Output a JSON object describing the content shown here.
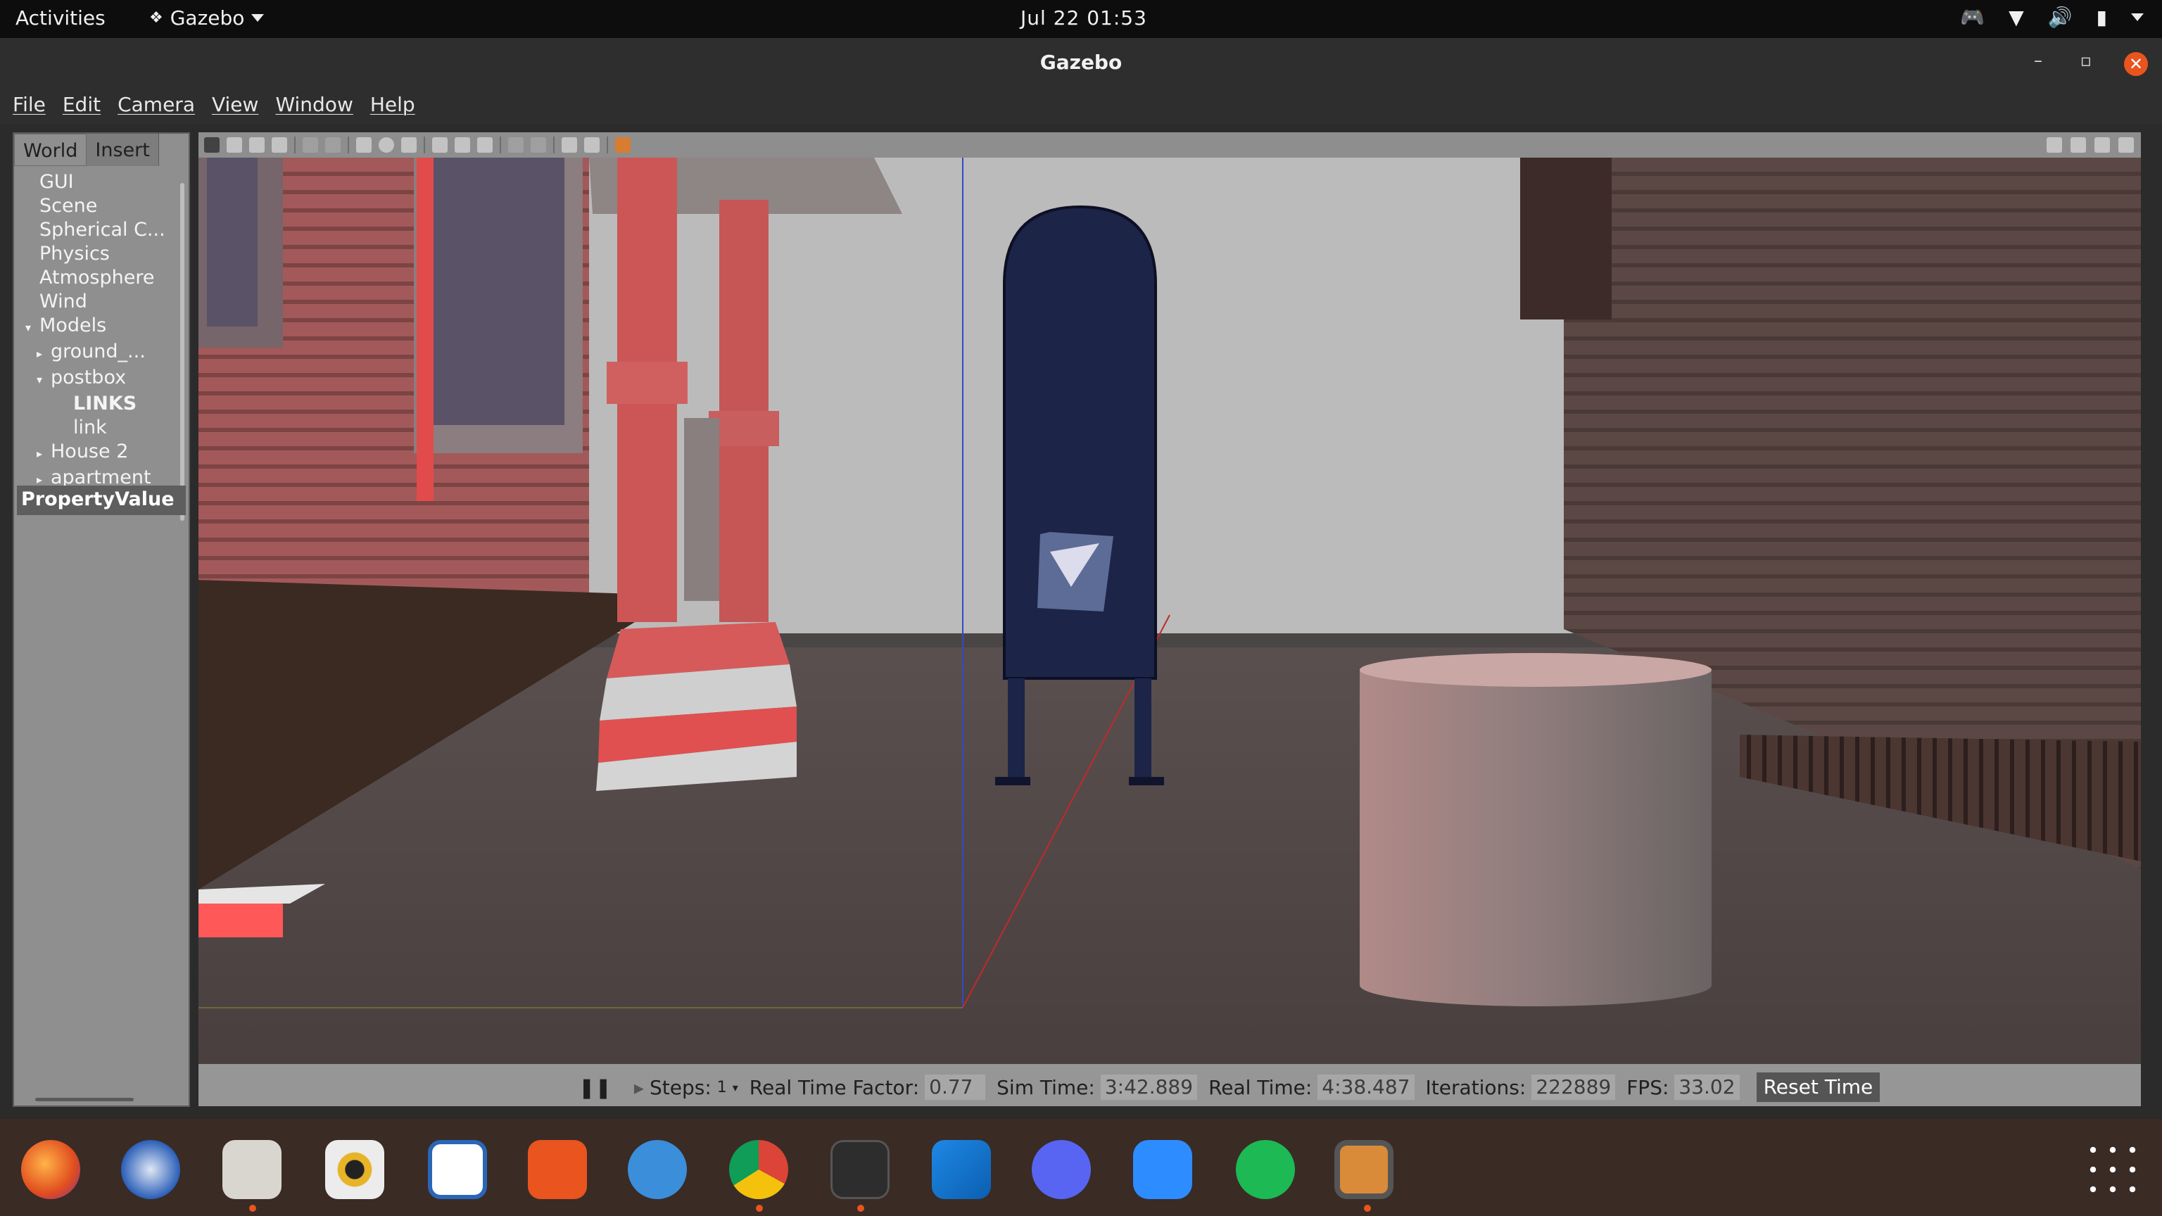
{
  "topbar": {
    "activities": "Activities",
    "app_name": "Gazebo",
    "clock": "Jul 22  01:53",
    "tray_icons": [
      "discord-tray-icon",
      "wifi-icon",
      "volume-icon",
      "battery-icon",
      "chevron-down-icon"
    ]
  },
  "window": {
    "title": "Gazebo",
    "minimize": "–",
    "maximize": "▫",
    "close": "✕"
  },
  "menu": [
    "File",
    "Edit",
    "Camera",
    "View",
    "Window",
    "Help"
  ],
  "left_panel": {
    "tabs": [
      "World",
      "Insert"
    ],
    "tree": [
      {
        "label": "GUI",
        "indent": 1,
        "arrow": ""
      },
      {
        "label": "Scene",
        "indent": 1,
        "arrow": ""
      },
      {
        "label": "Spherical C...",
        "indent": 1,
        "arrow": ""
      },
      {
        "label": "Physics",
        "indent": 1,
        "arrow": ""
      },
      {
        "label": "Atmosphere",
        "indent": 1,
        "arrow": ""
      },
      {
        "label": "Wind",
        "indent": 1,
        "arrow": ""
      },
      {
        "label": "Models",
        "indent": 1,
        "arrow": "▾"
      },
      {
        "label": "ground_...",
        "indent": 2,
        "arrow": "▸"
      },
      {
        "label": "postbox",
        "indent": 2,
        "arrow": "▾"
      },
      {
        "label": "LINKS",
        "indent": 3,
        "arrow": "",
        "bold": true
      },
      {
        "label": "link",
        "indent": 3,
        "arrow": ""
      },
      {
        "label": "House 2",
        "indent": 2,
        "arrow": "▸"
      },
      {
        "label": "apartment",
        "indent": 2,
        "arrow": "▸"
      }
    ],
    "property_header": "PropertyValue"
  },
  "status": {
    "steps_label": "Steps:",
    "steps_value": "1",
    "rtf_label": "Real Time Factor:",
    "rtf_value": "0.77",
    "sim_time_label": "Sim Time:",
    "sim_time_value": "3:42.889",
    "real_time_label": "Real Time:",
    "real_time_value": "4:38.487",
    "iterations_label": "Iterations:",
    "iterations_value": "222889",
    "fps_label": "FPS:",
    "fps_value": "33.02",
    "reset_label": "Reset Time"
  },
  "dock": [
    "firefox-icon",
    "thunderbird-icon",
    "files-icon",
    "rhythmbox-icon",
    "libreoffice-writer-icon",
    "ubuntu-software-icon",
    "help-icon",
    "chrome-icon",
    "terminal-icon",
    "vscode-icon",
    "discord-icon",
    "zoom-icon",
    "spotify-icon",
    "gazebo-icon",
    "app-grid-icon"
  ],
  "colors": {
    "accent": "#e9541f",
    "panel_bg": "#8f8f8f",
    "usps_blue": "#1a2240"
  }
}
